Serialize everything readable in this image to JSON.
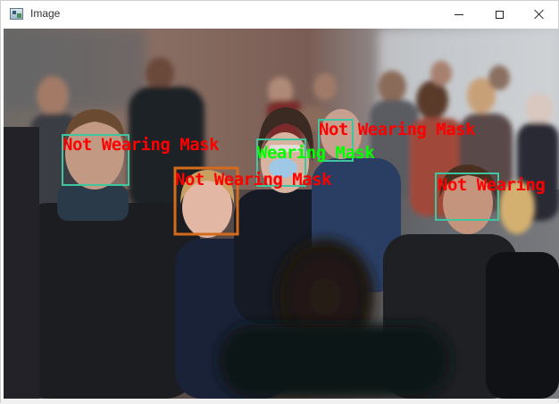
{
  "window": {
    "title": "Image",
    "icon": "image-window-icon"
  },
  "controls": {
    "minimize": "minimize-icon",
    "maximize": "maximize-icon",
    "close": "close-icon"
  },
  "detections": [
    {
      "label": "Not Wearing Mask",
      "box_color": "#3fc6a0",
      "text_color": "#ff0000"
    },
    {
      "label": "Not Wearing Mask",
      "box_color": "#d36a1c",
      "text_color": "#ff0000"
    },
    {
      "label": "Wearing Mask",
      "box_color": "#3fc6a0",
      "text_color": "#00ff00"
    },
    {
      "label": "Not Wearing Mask",
      "box_color": "#3fc6a0",
      "text_color": "#ff0000"
    },
    {
      "label": "Not Wearing",
      "box_color": "#3fc6a0",
      "text_color": "#ff0000"
    }
  ]
}
